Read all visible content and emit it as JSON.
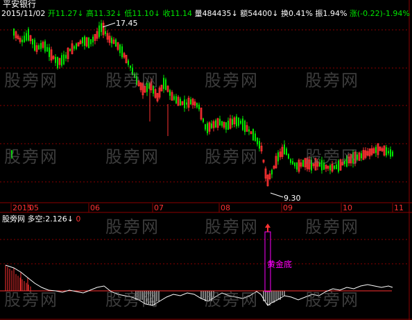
{
  "title": "平安银行",
  "quote": {
    "date": "2015/11/02",
    "open_label": "开",
    "open": "11.27",
    "high_label": "高",
    "high": "11.32",
    "low_label": "低",
    "low": "11.10",
    "close_label": "收",
    "close": "11.14",
    "volume_label": "量",
    "volume": "484435",
    "amount_label": "额",
    "amount": "54400",
    "turnover_label": "换",
    "turnover": "0.41%",
    "amplitude_label": "振",
    "amplitude": "1.94%",
    "change_label": "涨",
    "change": "(-0.22)-1.94%",
    "arrow": "↓"
  },
  "max_label": "17.45",
  "min_label": "9.30",
  "months": [
    "2015",
    "05",
    "06",
    "07",
    "08",
    "09",
    "10",
    "11"
  ],
  "watermark": "股旁网",
  "indicator": {
    "name": "股旁网",
    "series_label": "多空",
    "value": ":2.126",
    "arrow": "↓",
    "extra": "0",
    "signal": "黄金底"
  },
  "colors": {
    "up": "#ff3232",
    "down": "#00e600",
    "grid": "#8b0000",
    "axis_text": "#ff3232",
    "line": "#ffffff",
    "magenta": "#ff00ff"
  },
  "chart_data": {
    "type": "candlestick",
    "title": "平安银行",
    "x_ticks": [
      "2015",
      "05",
      "06",
      "07",
      "08",
      "09",
      "10",
      "11"
    ],
    "price_range": [
      9.3,
      17.45
    ],
    "max_price": 17.45,
    "min_price": 9.3,
    "last": {
      "date": "2015/11/02",
      "open": 11.27,
      "high": 11.32,
      "low": 11.1,
      "close": 11.14
    },
    "indicator": {
      "name": "多空",
      "value": 2.126,
      "signal": "黄金底"
    }
  }
}
